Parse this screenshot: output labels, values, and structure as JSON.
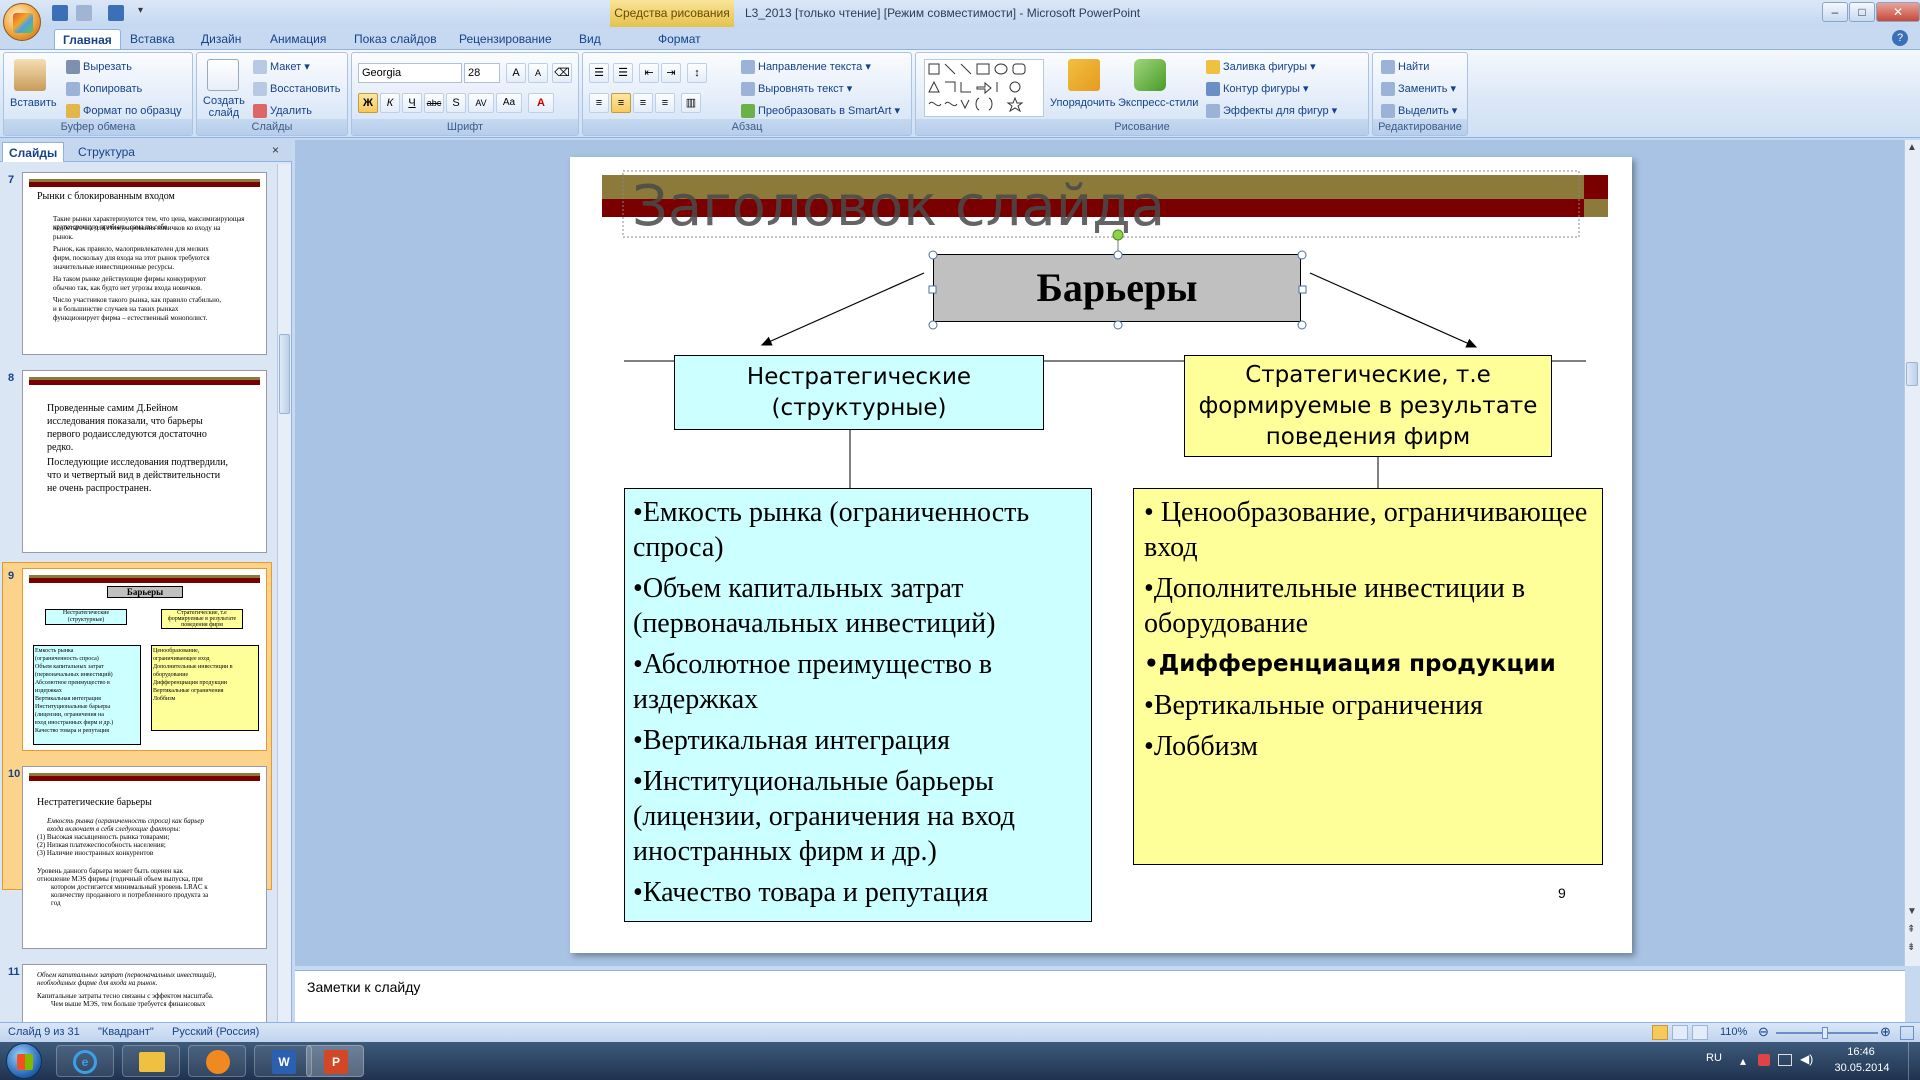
{
  "window": {
    "context_tab": "Средства рисования",
    "title": "L3_2013 [только чтение] [Режим совместимости] - Microsoft PowerPoint"
  },
  "tabs": [
    "Главная",
    "Вставка",
    "Дизайн",
    "Анимация",
    "Показ слайдов",
    "Рецензирование",
    "Вид",
    "Формат"
  ],
  "ribbon": {
    "clipboard": {
      "paste": "Вставить",
      "cut": "Вырезать",
      "copy": "Копировать",
      "format_painter": "Формат по образцу",
      "label": "Буфер обмена"
    },
    "slides": {
      "new_slide_1": "Создать",
      "new_slide_2": "слайд",
      "layout": "Макет",
      "reset": "Восстановить",
      "delete": "Удалить",
      "label": "Слайды"
    },
    "font": {
      "font_name": "Georgia",
      "font_size": "28",
      "label": "Шрифт"
    },
    "paragraph": {
      "text_direction": "Направление текста",
      "align_text": "Выровнять текст",
      "smartart": "Преобразовать в SmartArt",
      "label": "Абзац"
    },
    "drawing": {
      "arrange": "Упорядочить",
      "quick_styles": "Экспресс-стили",
      "fill": "Заливка фигуры",
      "outline": "Контур фигуры",
      "effects": "Эффекты для фигур",
      "label": "Рисование"
    },
    "editing": {
      "find": "Найти",
      "replace": "Заменить",
      "select": "Выделить",
      "label": "Редактирование"
    }
  },
  "panel": {
    "tab_slides": "Слайды",
    "tab_outline": "Структура",
    "thumbs": [
      {
        "num": "7",
        "title": "Рынки с блокированным входом",
        "lines": [
          "Такие рынки характеризуются тем, что цена, максимизирующая краткосрочную прибыль, сама по себе",
          "недостаточна для стимулирования новичков ко входу на",
          "рынок.",
          "Рынок, как правило, малопривлекателен для мелких",
          "фирм, поскольку для входа на этот рынок требуются",
          "значительные инвестиционные ресурсы.",
          "На таком рынке действующие фирмы конкурируют",
          "обычно так, как будто нет угрозы входа новичков.",
          "Число участников такого рынка, как правило стабильно,",
          "и в большинстве случаев на таких рынках",
          "функционирует фирма – естественный монополист."
        ]
      },
      {
        "num": "8",
        "lines": [
          "Проведенные самим Д.Бейном",
          "исследования показали, что барьеры",
          "первого родаисследуются достаточно",
          "редко.",
          "Последующие исследования подтвердили,",
          "что и четвертый вид в действительности",
          "не очень распространен."
        ]
      },
      {
        "num": "9",
        "title": "Барьеры",
        "left_head": "Нестратегические (структурные)",
        "right_head": "Стратегические, т.е формируемые в результате поведения фирм",
        "left_lines": [
          "Емкость рынка",
          "(ограниченность спроса)",
          "Объем капитальных затрат",
          "(первоначальных инвестиций)",
          "Абсолютное преимущество в",
          "издержках",
          "Вертикальная интеграция",
          "Институциональные барьеры",
          "(лицензии, ограничения на",
          "вход иностранных фирм и др.)",
          "Качество товара и репутация"
        ],
        "right_lines": [
          "Ценообразование,",
          "ограничивающее вход",
          "Дополнительные инвестиции в",
          "оборудование",
          "Дифференциация продукции",
          "Вертикальные ограничения",
          "Лоббизм"
        ]
      },
      {
        "num": "10",
        "title": "Нестратегические барьеры",
        "lines": [
          "Емкость рынка (ограниченность спроса) как барьер",
          "входа включает в себя следующие факторы:",
          "(1) Высокая насыщенность рынка товарами;",
          "(2) Низкая платежеспособность населения;",
          "(3) Наличие иностранных конкурентов",
          "Уровень данного барьера может быть оценен как",
          "отношение MЭS фирмы (годичный объем выпуска, при",
          "котором достигается минимальный уровень LRAC к",
          "количеству проданного и потребленного продукта за",
          "год"
        ]
      },
      {
        "num": "11",
        "lines": [
          "Объем капитальных затрат (первоначальных инвестиций),",
          "необходимых фирме для входа на рынок.",
          "Капитальные затраты тесно связаны с эффектом масштаба.",
          "Чем выше MЭS, тем больше требуется финансовых"
        ]
      }
    ]
  },
  "slide": {
    "title_placeholder": "Заголовок слайда",
    "center": "Барьеры",
    "left_head": "Нестратегические (структурные)",
    "right_head": "Стратегические, т.е формируемые в результате поведения фирм",
    "left_items": [
      "Емкость рынка (ограниченность спроса)",
      "Объем капитальных затрат (первоначальных инвестиций)",
      "Абсолютное преимущество в издержках",
      "Вертикальная интеграция",
      "Институциональные барьеры (лицензии, ограничения на вход иностранных фирм и др.)",
      "Качество товара и репутация"
    ],
    "right_items": [
      " Ценообразование, ограничивающее вход",
      "Дополнительные инвестиции в оборудование",
      "Дифференциация продукции",
      "Вертикальные ограничения",
      "Лоббизм"
    ],
    "page_number": "9"
  },
  "notes_placeholder": "Заметки к слайду",
  "status": {
    "slide": "Слайд 9 из 31",
    "theme": "\"Квадрант\"",
    "lang": "Русский (Россия)",
    "zoom": "110%"
  },
  "taskbar": {
    "lang": "RU",
    "time": "16:46",
    "date": "30.05.2014"
  },
  "colors": {
    "left_fill": "#ccffff",
    "right_fill": "#ffff99",
    "center_fill": "#c0c0c0",
    "bar_olive": "#8c7a3a",
    "bar_maroon": "#7a0000"
  }
}
